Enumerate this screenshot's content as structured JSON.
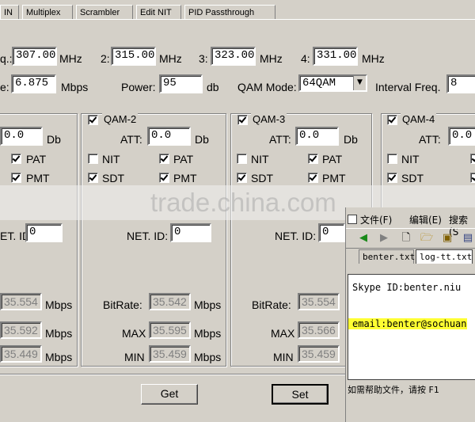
{
  "tabs": [
    "IN",
    "Multiplex",
    "Scrambler",
    "Edit NIT",
    "PID Passthrough"
  ],
  "freq": {
    "label_1_partial": "q.:",
    "f1": "307.000",
    "f2": "315.000",
    "f3": "323.000",
    "f4": "331.000",
    "label_2": "2:",
    "label_3": "3:",
    "label_4": "4:",
    "unit": "MHz"
  },
  "symbol": {
    "label_partial": "e:",
    "value": "6.875",
    "unit": "Mbps"
  },
  "power": {
    "label": "Power:",
    "value": "95",
    "unit": "db"
  },
  "qam_mode": {
    "label": "QAM Mode:",
    "value": "64QAM"
  },
  "interval": {
    "label": "Interval Freq.",
    "value": "8"
  },
  "groups": [
    {
      "att": "0.0",
      "att_unit": "Db",
      "pat": "PAT",
      "pmt": "PMT",
      "net_label": "ET. ID:",
      "net": "0",
      "bitrate": "35.554",
      "max": "35.592",
      "min": "35.449",
      "unit": "Mbps"
    },
    {
      "title": "QAM-2",
      "att_label": "ATT:",
      "att": "0.0",
      "att_unit": "Db",
      "nit": "NIT",
      "pat": "PAT",
      "sdt": "SDT",
      "pmt": "PMT",
      "net_label": "NET. ID:",
      "net": "0",
      "bitrate_label": "BitRate:",
      "bitrate": "35.542",
      "max_label": "MAX",
      "max": "35.595",
      "min_label": "MIN",
      "min": "35.459",
      "unit": "Mbps"
    },
    {
      "title": "QAM-3",
      "att_label": "ATT:",
      "att": "0.0",
      "att_unit": "Db",
      "nit": "NIT",
      "pat": "PAT",
      "sdt": "SDT",
      "pmt": "PMT",
      "net_label": "NET. ID:",
      "net": "0",
      "bitrate_label": "BitRate:",
      "bitrate": "35.554",
      "max_label": "MAX",
      "max": "35.566",
      "min_label": "MIN",
      "min": "35.459"
    },
    {
      "title": "QAM-4",
      "att_label": "ATT:",
      "att": "0.0",
      "nit": "NIT",
      "sdt": "SDT"
    }
  ],
  "buttons": {
    "get": "Get",
    "set": "Set"
  },
  "watermark": "trade.china.com",
  "notepad": {
    "menu": [
      "文件(F)",
      "编辑(E)",
      "搜索(S"
    ],
    "doc_tabs": [
      "benter.txt",
      "log-tt.txt"
    ],
    "lines": [
      "Skype ID:benter.niu",
      "email:benter@sochuan"
    ],
    "status": "如需帮助文件，请按 F1"
  }
}
